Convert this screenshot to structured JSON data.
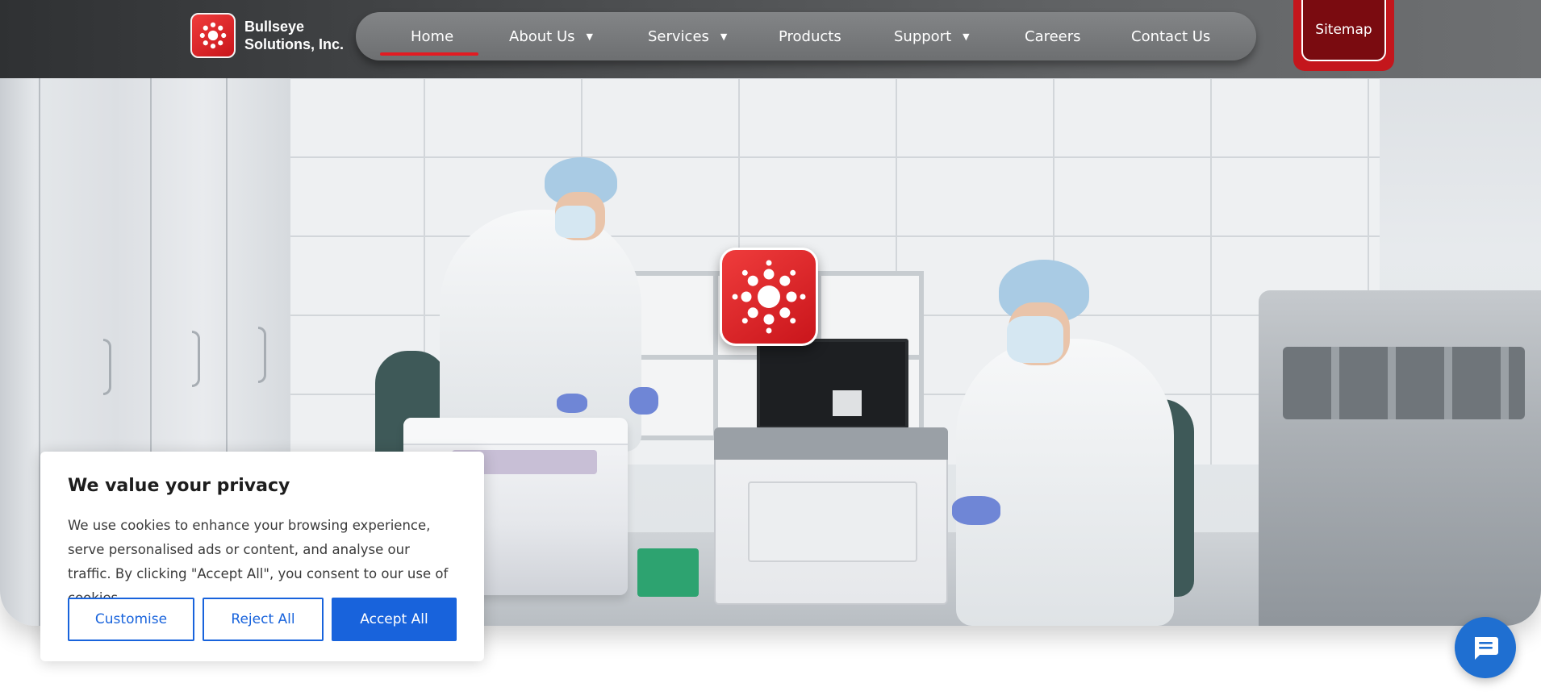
{
  "brand": {
    "name_line1": "Bullseye",
    "name_line2": "Solutions, Inc.",
    "logo_icon": "sunburst-logo-icon",
    "accent_color": "#e21b22"
  },
  "nav": {
    "items": [
      {
        "label": "Home",
        "active": true,
        "has_dropdown": false
      },
      {
        "label": "About Us",
        "active": false,
        "has_dropdown": true
      },
      {
        "label": "Services",
        "active": false,
        "has_dropdown": true
      },
      {
        "label": "Products",
        "active": false,
        "has_dropdown": false
      },
      {
        "label": "Support",
        "active": false,
        "has_dropdown": true
      },
      {
        "label": "Careers",
        "active": false,
        "has_dropdown": false
      },
      {
        "label": "Contact Us",
        "active": false,
        "has_dropdown": false
      }
    ],
    "caret_glyph": "▼"
  },
  "sitemap": {
    "label": "Sitemap"
  },
  "hero": {
    "logo_icon": "sunburst-logo-icon"
  },
  "cookie_banner": {
    "title": "We value your privacy",
    "body": "We use cookies to enhance your browsing experience, serve personalised ads or content, and analyse our traffic. By clicking \"Accept All\", you consent to our use of cookies.",
    "customise_label": "Customise",
    "reject_label": "Reject All",
    "accept_label": "Accept All",
    "button_color": "#1863dc"
  },
  "chat_widget": {
    "icon": "chat-bubble-icon",
    "color": "#1f6fd1"
  }
}
